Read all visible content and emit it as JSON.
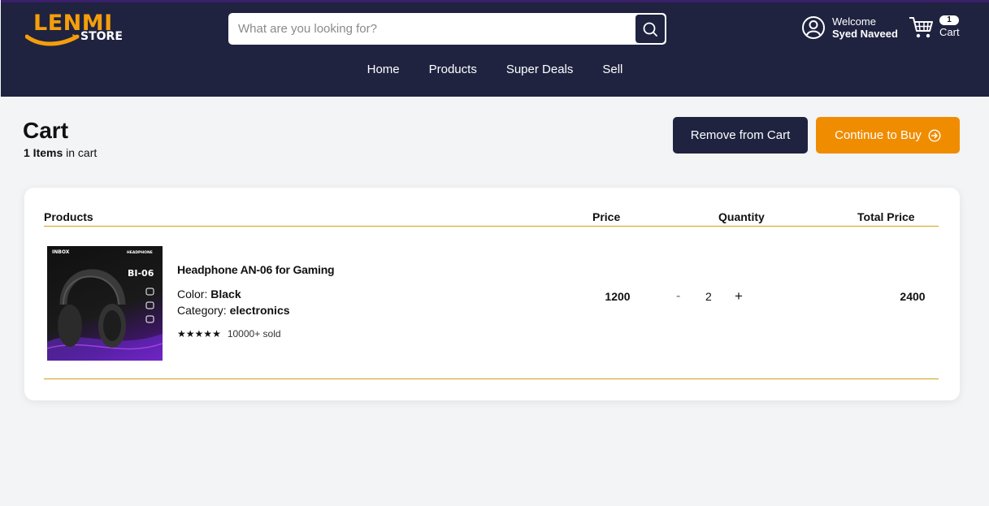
{
  "header": {
    "logo_main": "LENMI",
    "logo_sub": "STORE",
    "search_placeholder": "What are you looking for?",
    "user_greeting": "Welcome",
    "user_name": "Syed Naveed",
    "cart_count": "1",
    "cart_label": "Cart",
    "nav": [
      "Home",
      "Products",
      "Super Deals",
      "Sell"
    ]
  },
  "page": {
    "title": "Cart",
    "items_count": "1 Items",
    "items_suffix": "in cart",
    "remove_label": "Remove from Cart",
    "continue_label": "Continue to Buy"
  },
  "table": {
    "headers": {
      "products": "Products",
      "price": "Price",
      "quantity": "Quantity",
      "total": "Total Price"
    },
    "items": [
      {
        "name": "Headphone AN-06 for Gaming",
        "color_label": "Color:",
        "color": "Black",
        "category_label": "Category:",
        "category": "electronics",
        "rating_stars": 5,
        "sold": "10000+ sold",
        "price": "1200",
        "quantity": "2",
        "total": "2400",
        "image_text": {
          "brand": "INBOX",
          "model": "BI-06",
          "tag": "HEADPHONE"
        }
      }
    ]
  },
  "colors": {
    "navy": "#1f2340",
    "accent_orange": "#f08c00",
    "divider_gold": "#d4a017"
  }
}
